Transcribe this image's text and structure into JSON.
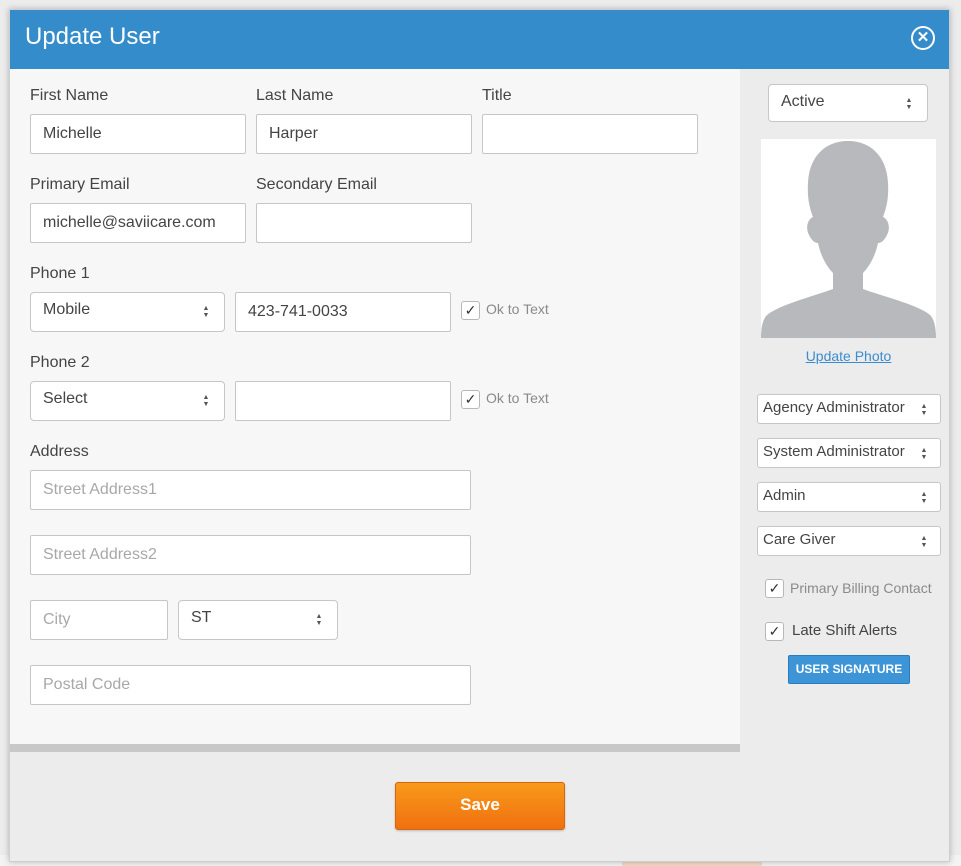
{
  "modal": {
    "title": "Update User",
    "close_icon": "close-circle-icon"
  },
  "form": {
    "first_name": {
      "label": "First Name",
      "value": "Michelle"
    },
    "last_name": {
      "label": "Last Name",
      "value": "Harper"
    },
    "title": {
      "label": "Title",
      "value": ""
    },
    "primary_email": {
      "label": "Primary Email",
      "value": "michelle@saviicare.com"
    },
    "secondary_email": {
      "label": "Secondary Email",
      "value": ""
    },
    "phone1": {
      "label": "Phone 1",
      "type": "Mobile",
      "number": "423-741-0033",
      "ok_to_text_label": "Ok to Text",
      "ok_to_text": true
    },
    "phone2": {
      "label": "Phone 2",
      "type": "Select",
      "number": "",
      "ok_to_text_label": "Ok to Text",
      "ok_to_text": true
    },
    "address": {
      "label": "Address",
      "street1_placeholder": "Street Address1",
      "street2_placeholder": "Street Address2",
      "city_placeholder": "City",
      "state": "ST",
      "postal_placeholder": "Postal Code"
    }
  },
  "side": {
    "status": "Active",
    "update_photo_label": "Update Photo",
    "roles": [
      "Agency Administrator",
      "System Administrator",
      "Admin",
      "Care Giver"
    ],
    "primary_billing_label": "Primary Billing Contact",
    "primary_billing_checked": true,
    "late_shift_label": "Late Shift Alerts",
    "late_shift_checked": true,
    "signature_button": "USER SIGNATURE"
  },
  "footer": {
    "save_label": "Save"
  },
  "colors": {
    "header": "#348ccb",
    "save": "#f28a16",
    "link": "#3a8ccf"
  }
}
